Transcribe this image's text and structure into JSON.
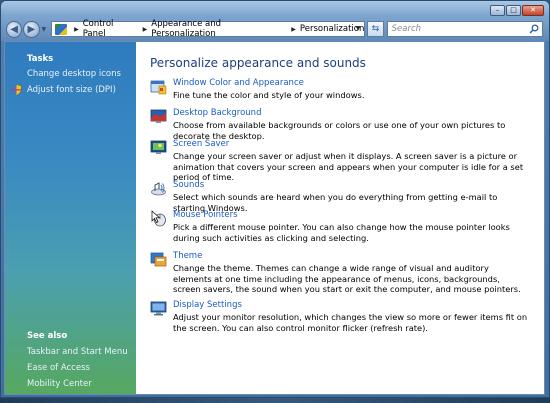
{
  "window": {
    "controls": {
      "minimize": "–",
      "maximize": "□",
      "close": "✕"
    }
  },
  "address": {
    "crumbs": [
      "Control Panel",
      "Appearance and Personalization",
      "Personalization"
    ],
    "search_placeholder": "Search"
  },
  "sidebar": {
    "tasks_heading": "Tasks",
    "tasks": [
      "Change desktop icons",
      "Adjust font size (DPI)"
    ],
    "see_also_heading": "See also",
    "see_also": [
      "Taskbar and Start Menu",
      "Ease of Access",
      "Mobility Center"
    ]
  },
  "main": {
    "title": "Personalize appearance and sounds",
    "items": [
      {
        "icon": "window-color-icon",
        "label": "Window Color and Appearance",
        "desc": "Fine tune the color and style of your windows."
      },
      {
        "icon": "desktop-background-icon",
        "label": "Desktop Background",
        "desc": "Choose from available backgrounds or colors or use one of your own pictures to decorate the desktop."
      },
      {
        "icon": "screen-saver-icon",
        "label": "Screen Saver",
        "desc": "Change your screen saver or adjust when it displays. A screen saver is a picture or animation that covers your screen and appears when your computer is idle for a set period of time."
      },
      {
        "icon": "sounds-icon",
        "label": "Sounds",
        "desc": "Select which sounds are heard when you do everything from getting e-mail to starting Windows."
      },
      {
        "icon": "mouse-pointer-icon",
        "label": "Mouse Pointers",
        "desc": "Pick a different mouse pointer. You can also change how the mouse pointer looks during such activities as clicking and selecting."
      },
      {
        "icon": "theme-icon",
        "label": "Theme",
        "desc": "Change the theme. Themes can change a wide range of visual and auditory elements at one time including the appearance of menus, icons, backgrounds, screen savers, the sound when you start or exit the computer, and mouse pointers."
      },
      {
        "icon": "display-settings-icon",
        "label": "Display Settings",
        "desc": "Adjust your monitor resolution, which changes the view so more or fewer items fit on the screen. You can also control monitor flicker (refresh rate)."
      }
    ]
  }
}
